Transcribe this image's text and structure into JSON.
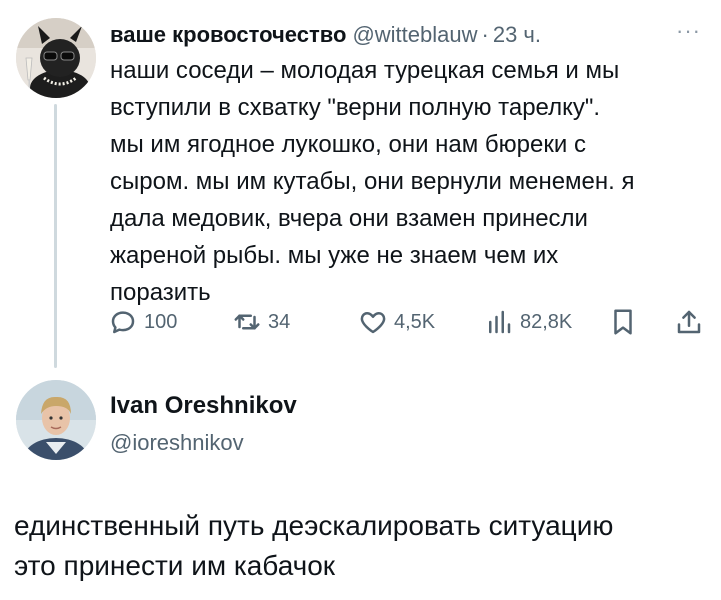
{
  "tweet": {
    "author_name": "ваше кровосточество",
    "handle": "@witteblauw",
    "separator": "·",
    "time": "23 ч.",
    "more": "···",
    "text_lines": [
      "наши соседи – молодая турецкая семья и мы",
      "вступили в схватку \"верни полную тарелку\".",
      "мы им ягодное лукошко, они нам бюреки с",
      "сыром. мы им кутабы, они вернули менемен. я",
      "дала медовик, вчера они взамен принесли",
      "жареной рыбы. мы уже не знаем чем их",
      "поразить"
    ],
    "actions": {
      "reply_count": "100",
      "retweet_count": "34",
      "like_count": "4,5K",
      "views_count": "82,8K"
    },
    "icons": [
      "reply-icon",
      "retweet-icon",
      "like-icon",
      "views-icon",
      "bookmark-icon",
      "share-icon"
    ]
  },
  "reply": {
    "author_name": "Ivan Oreshnikov",
    "handle": "@ioreshnikov",
    "text_lines": [
      "единственный путь деэскалировать ситуацию",
      "это принести им кабачок"
    ]
  },
  "colors": {
    "text": "#0f1419",
    "secondary": "#536471",
    "thread_line": "#cfd9de"
  }
}
